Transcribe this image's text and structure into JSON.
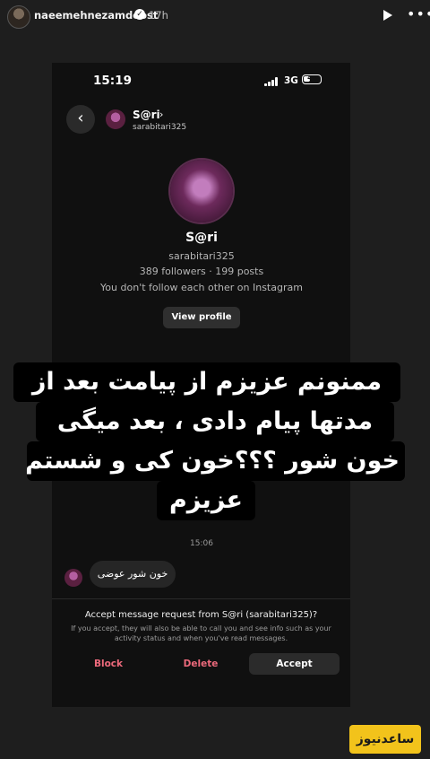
{
  "story": {
    "username": "naeemehnezamdoost",
    "time": "17h",
    "icons": {
      "play": "play-icon",
      "more": "more-icon",
      "verified": "verified-badge-icon"
    }
  },
  "status_bar": {
    "time": "15:19",
    "network": "3G",
    "battery": "40"
  },
  "chat_header": {
    "name": "S@ri",
    "chevron": "›",
    "username": "sarabitari325"
  },
  "profile": {
    "name": "S@ri",
    "username": "sarabitari325",
    "stats": "389 followers · 199 posts",
    "follow_note": "You don't follow each other on Instagram",
    "view_profile_label": "View profile"
  },
  "caption_lines": [
    "ممنونم عزیزم از پیامت بعد از",
    "مدتها  پیام دادی ، بعد میگی",
    "خون شور ؟؟؟خون کی و شستم",
    "عزیزم"
  ],
  "messages": {
    "time": "15:06",
    "bubble_text": "خون شور عوضی"
  },
  "request": {
    "title": "Accept message request from S@ri (sarabitari325)?",
    "body": "If you accept, they will also be able to call you and see info such as your activity status and when you've read messages.",
    "block_label": "Block",
    "delete_label": "Delete",
    "accept_label": "Accept"
  },
  "watermark": "ساعدنیوز",
  "colors": {
    "danger": "#ed6a7c",
    "watermark_bg": "#f2c31b",
    "background": "#1e1e1e",
    "phone_bg": "#101010"
  }
}
